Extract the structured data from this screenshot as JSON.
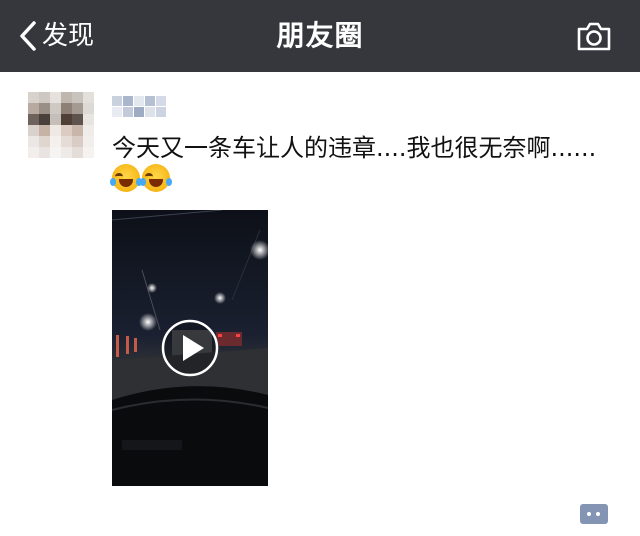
{
  "navbar": {
    "back_label": "发现",
    "title": "朋友圈",
    "back_icon": "chevron-left-icon",
    "camera_icon": "camera-icon"
  },
  "post": {
    "text": "今天又一条车让人的违章....我也很无奈啊......",
    "emojis": [
      "crying-laughing-emoji",
      "crying-laughing-emoji"
    ],
    "media_type": "video",
    "play_icon": "play-icon",
    "comment_icon": "comment-dots-icon"
  },
  "colors": {
    "navbar_bg": "#36373c",
    "comment_accent": "#8495b3"
  }
}
